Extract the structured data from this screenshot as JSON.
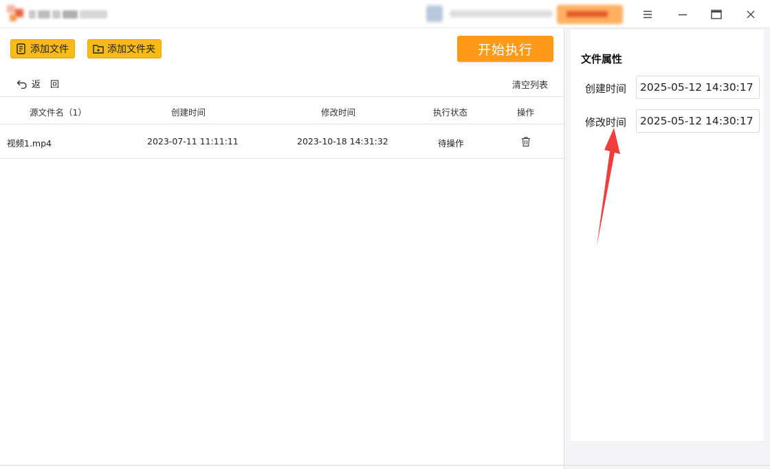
{
  "toolbar": {
    "add_file_label": "添加文件",
    "add_folder_label": "添加文件夹",
    "start_label": "开始执行"
  },
  "nav": {
    "back_label": "返回",
    "clear_list_label": "清空列表"
  },
  "table": {
    "headers": [
      "源文件名（1）",
      "创建时间",
      "修改时间",
      "执行状态",
      "操作"
    ],
    "rows": [
      {
        "name": "视频1.mp4",
        "created": "2023-07-11 11:11:11",
        "modified": "2023-10-18 14:31:32",
        "status": "待操作"
      }
    ]
  },
  "properties": {
    "title": "文件属性",
    "created_label": "创建时间",
    "created_value": "2025-05-12 14:30:17",
    "modified_label": "修改时间",
    "modified_value": "2025-05-12 14:30:17"
  },
  "icons": {
    "menu": "menu-icon",
    "minimize": "minimize-icon",
    "maximize": "maximize-icon",
    "close": "close-icon",
    "back": "back-arrow-icon",
    "delete": "trash-icon",
    "annotation": "red-arrow-icon"
  },
  "colors": {
    "accent_yellow": "#f7bb13",
    "start_orange": "#ff9a16",
    "annotation_red": "#f23d3d"
  }
}
